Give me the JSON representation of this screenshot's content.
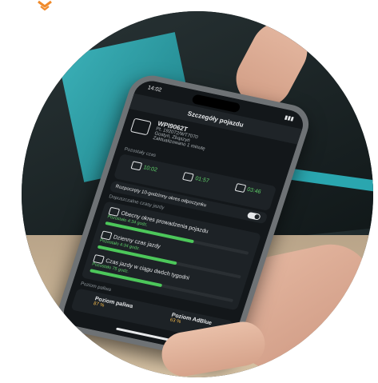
{
  "brand": {
    "logo_icon": "chevron-down-logo-icon",
    "logo_color": "#f08a2a"
  },
  "phone": {
    "status_time": "14:02",
    "title": "Szczegóły pojazdu",
    "vehicle": {
      "plate": "WPI9062T",
      "line1": "Pt. 192072/WT7070",
      "line2": "Gostyń, Zbąszyń",
      "line3": "Zaktualizowano 1 minutę"
    },
    "section_drivers": "Pozostały czas",
    "drive_stats": [
      "10:02",
      "01:57",
      "03:46"
    ],
    "rest_label": "Rozpoczęty 10-godzinny okres odpoczynku",
    "section_day": "Dopuszczalne czasy jazdy",
    "rows": [
      {
        "title": "Obecny okres prowadzenia pojazdu",
        "sub": "Pozostało 4:34 godz.",
        "fill": 0.62
      },
      {
        "title": "Dzienny czas jazdy",
        "sub": "Pozostało 4:34 godz.",
        "fill": 0.55
      },
      {
        "title": "Czas jazdy w ciągu dwóch tygodni",
        "sub": "Pozostało 75 godz.",
        "fill": 0.5
      }
    ],
    "section_fuel": "Poziom paliwa",
    "fuel": [
      {
        "label": "Poziom paliwa",
        "value": "87 %"
      },
      {
        "label": "Poziom AdBlue",
        "value": "63 %"
      }
    ]
  },
  "colors": {
    "accent_green": "#4cc75a",
    "warning_amber": "#f2b84b",
    "teal": "#2aa6af"
  }
}
